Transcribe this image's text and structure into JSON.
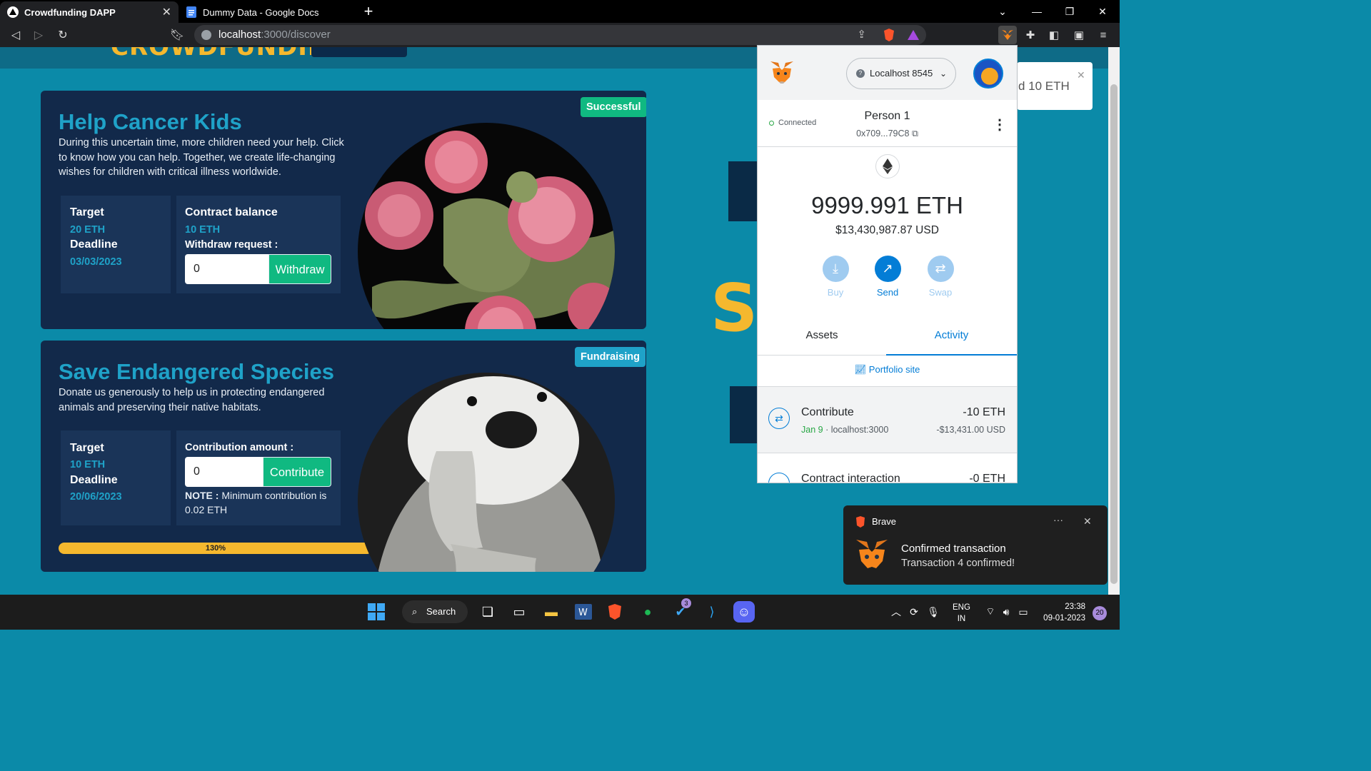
{
  "browser": {
    "tabs": [
      {
        "title": "Crowdfunding DAPP",
        "active": true
      },
      {
        "title": "Dummy Data - Google Docs",
        "active": false
      }
    ],
    "new_tab": "+",
    "url_host": "localhost",
    "url_path": ":3000/discover"
  },
  "page": {
    "brand": "CROWDFUNDING",
    "campaigns": [
      {
        "title": "Help Cancer Kids",
        "description": "During this uncertain time, more children need your help. Click to know how you can help. Together, we create life-changing wishes for children with critical illness worldwide.",
        "status": "Successful",
        "target_label": "Target",
        "target_value": "20 ETH",
        "deadline_label": "Deadline",
        "deadline_value": "03/03/2023",
        "balance_label": "Contract balance",
        "balance_value": "10 ETH",
        "withdraw_label": "Withdraw request :",
        "withdraw_input": "0",
        "withdraw_button": "Withdraw"
      },
      {
        "title": "Save Endangered Species",
        "description": "Donate us generously to help us in protecting endangered animals and preserving their native habitats.",
        "status": "Fundraising",
        "target_label": "Target",
        "target_value": "10 ETH",
        "deadline_label": "Deadline",
        "deadline_value": "20/06/2023",
        "contribution_label": "Contribution amount :",
        "contribution_input": "0",
        "contribute_button": "Contribute",
        "note_bold": "NOTE :",
        "note_text": " Minimum contribution is 0.02 ETH",
        "progress_label": "130%",
        "progress_fraction": 1.0
      }
    ],
    "toast_text": "d 10 ETH",
    "toast_close": "✕"
  },
  "metamask": {
    "network": "Localhost 8545",
    "network_q": "?",
    "connected_label": "Connected",
    "account_name": "Person 1",
    "account_address": "0x709...79C8",
    "balance": "9999.991 ETH",
    "balance_usd": "$13,430,987.87 USD",
    "actions": [
      {
        "label": "Buy",
        "icon": "download-icon"
      },
      {
        "label": "Send",
        "icon": "arrow-up-right-icon"
      },
      {
        "label": "Swap",
        "icon": "swap-icon"
      }
    ],
    "tabs": {
      "assets": "Assets",
      "activity": "Activity"
    },
    "portfolio": "Portfolio site",
    "transactions": [
      {
        "title": "Contribute",
        "date": "Jan 9",
        "origin": " · localhost:3000",
        "amount": "-10 ETH",
        "usd": "-$13,431.00 USD"
      },
      {
        "title": "Contract interaction",
        "amount": "-0 ETH"
      }
    ]
  },
  "notification": {
    "app": "Brave",
    "more": "···",
    "close": "✕",
    "title": "Confirmed transaction",
    "body": "Transaction 4 confirmed!"
  },
  "taskbar": {
    "search": "Search",
    "lang1": "ENG",
    "lang2": "IN",
    "time": "23:38",
    "date": "09-01-2023",
    "notif_count": "20",
    "todo_badge": "3"
  }
}
